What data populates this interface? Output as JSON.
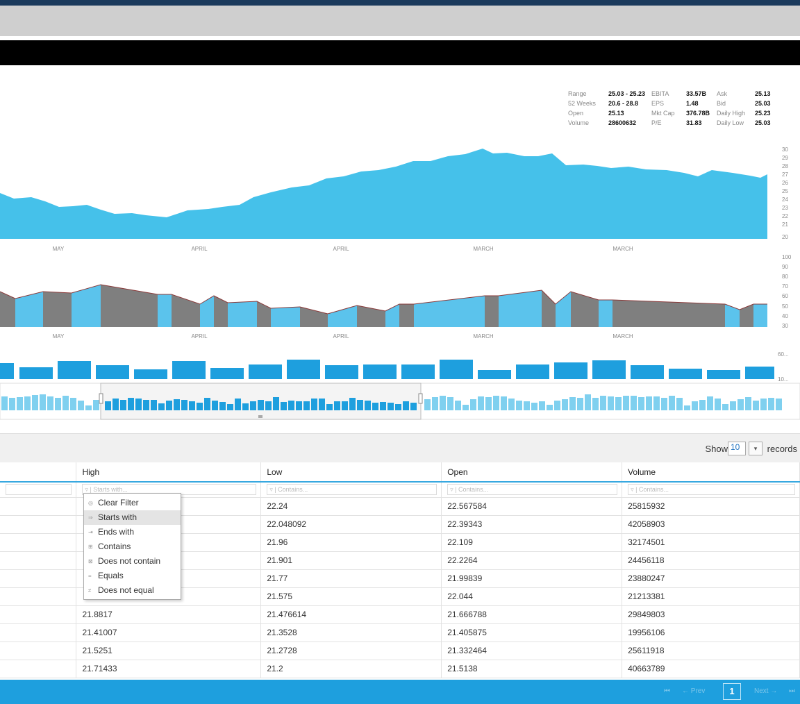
{
  "stats": {
    "rows": [
      {
        "l1": "Range",
        "v1": "25.03 - 25.23",
        "l2": "EBITA",
        "v2": "33.57B",
        "l3": "Ask",
        "v3": "25.13"
      },
      {
        "l1": "52 Weeks",
        "v1": "20.6 - 28.8",
        "l2": "EPS",
        "v2": "1.48",
        "l3": "Bid",
        "v3": "25.03"
      },
      {
        "l1": "Open",
        "v1": "25.13",
        "l2": "Mkt Cap",
        "v2": "376.78B",
        "l3": "Daily High",
        "v3": "25.23"
      },
      {
        "l1": "Volume",
        "v1": "28600632",
        "l2": "P/E",
        "v2": "31.83",
        "l3": "Daily Low",
        "v3": "25.03"
      }
    ]
  },
  "charts": {
    "month_labels": [
      "MAY",
      "APRIL",
      "APRIL",
      "MARCH",
      "MARCH"
    ],
    "price_axis": [
      "30",
      "29",
      "28",
      "27",
      "26",
      "25",
      "24",
      "23",
      "22",
      "21",
      "20"
    ],
    "volume_axis": [
      "100",
      "90",
      "80",
      "70",
      "60",
      "50",
      "40",
      "30"
    ],
    "bars_axis": [
      "60...",
      "10..."
    ],
    "colors": {
      "area": "#45c1ea",
      "bar": "#1e9fde",
      "grey": "#7f7f7f",
      "light": "#5bc3ec"
    }
  },
  "toolbar": {
    "show": "Show",
    "records_value": "10",
    "records": "records"
  },
  "grid": {
    "headers": [
      "High",
      "Low",
      "Open",
      "Volume"
    ],
    "filter_placeholders": [
      "Starts with...",
      "Contains...",
      "Contains...",
      "Contains..."
    ],
    "rows": [
      [
        "",
        "22.24",
        "22.567584",
        "25815932"
      ],
      [
        "",
        "22.048092",
        "22.39343",
        "42058903"
      ],
      [
        "",
        "21.96",
        "22.109",
        "32174501"
      ],
      [
        "",
        "21.901",
        "22.2264",
        "24456118"
      ],
      [
        "",
        "21.77",
        "21.99839",
        "23880247"
      ],
      [
        "",
        "21.575",
        "22.044",
        "21213381"
      ],
      [
        "21.8817",
        "21.476614",
        "21.666788",
        "29849803"
      ],
      [
        "21.41007",
        "21.3528",
        "21.405875",
        "19956106"
      ],
      [
        "21.5251",
        "21.2728",
        "21.332464",
        "25611918"
      ],
      [
        "21.71433",
        "21.2",
        "21.5138",
        "40663789"
      ]
    ]
  },
  "filter_menu": {
    "items": [
      {
        "label": "Clear Filter",
        "icon": "clear-icon"
      },
      {
        "label": "Starts with",
        "icon": "starts-with-icon"
      },
      {
        "label": "Ends with",
        "icon": "ends-with-icon"
      },
      {
        "label": "Contains",
        "icon": "contains-icon"
      },
      {
        "label": "Does not contain",
        "icon": "does-not-contain-icon"
      },
      {
        "label": "Equals",
        "icon": "equals-icon"
      },
      {
        "label": "Does not equal",
        "icon": "does-not-equal-icon"
      }
    ]
  },
  "pager": {
    "first": "⏮",
    "prev": "← Prev",
    "page": "1",
    "next": "Next →",
    "last": "⏭"
  }
}
